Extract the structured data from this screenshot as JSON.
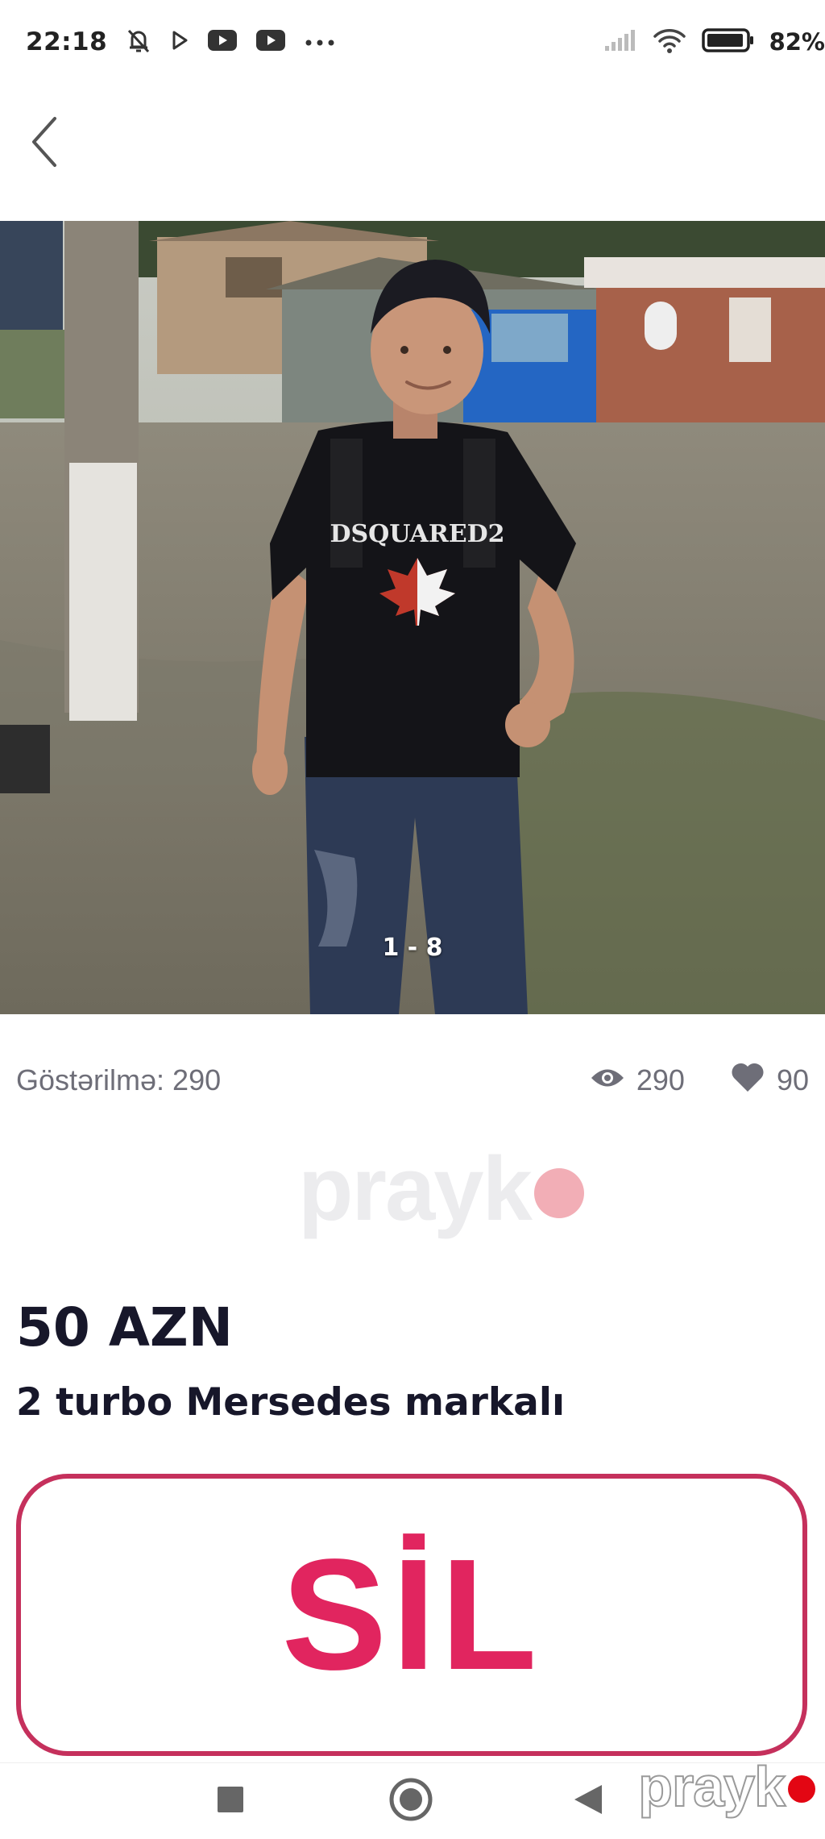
{
  "status_bar": {
    "time": "22:18",
    "battery_percent": "82%"
  },
  "photo": {
    "counter": "1 - 8",
    "shirt_text": "DSQUARED2"
  },
  "stats": {
    "impressions_label": "Göstərilmə: 290",
    "views": "290",
    "likes": "90"
  },
  "watermark": {
    "text": "prayk"
  },
  "listing": {
    "price": "50 AZN",
    "title": "2 turbo Mersedes markalı"
  },
  "action": {
    "label": "SİL"
  },
  "nav_watermark": {
    "text": "prayk"
  },
  "colors": {
    "accent": "#e1255f",
    "button_border": "#c5305c",
    "muted_text": "#6e6e78",
    "title_text": "#17172a",
    "watermark_dot": "#f2aeb6"
  },
  "icons": {
    "back": "chevron-left-icon",
    "views": "eye-icon",
    "likes": "heart-icon",
    "nav_recent": "square-icon",
    "nav_home": "circle-icon",
    "nav_back": "triangle-left-icon"
  }
}
